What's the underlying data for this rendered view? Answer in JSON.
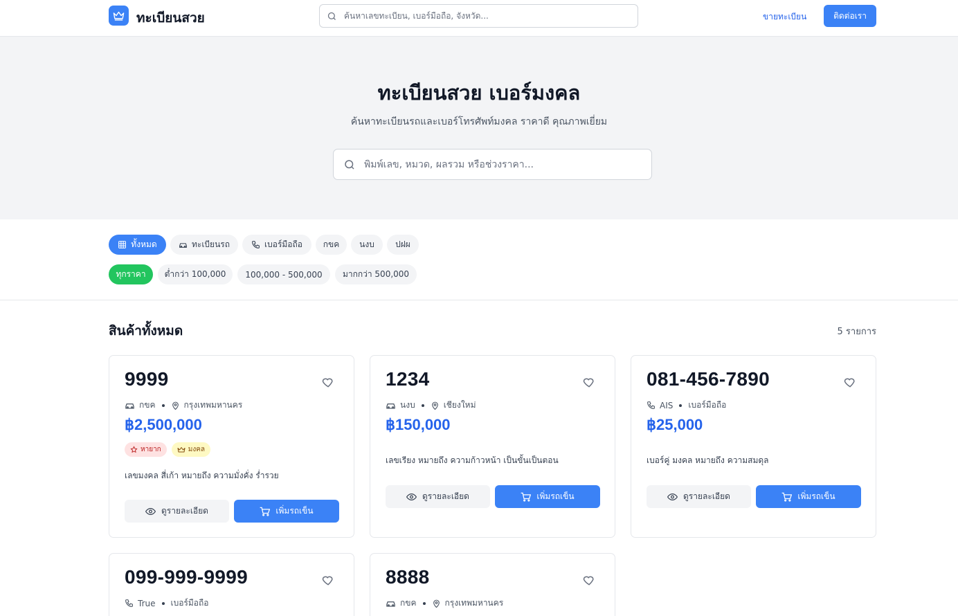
{
  "header": {
    "logo_text": "ทะเบียนสวย",
    "search_placeholder": "ค้นหาเลขทะเบียน, เบอร์มือถือ, จังหวัด...",
    "sell_link": "ขายทะเบียน",
    "contact_button": "ติดต่อเรา"
  },
  "hero": {
    "title": "ทะเบียนสวย เบอร์มงคล",
    "subtitle": "ค้นหาทะเบียนรถและเบอร์โทรศัพท์มงคล ราคาดี คุณภาพเยี่ยม",
    "search_placeholder": "พิมพ์เลข, หมวด, ผลรวม หรือช่วงราคา..."
  },
  "category_filters": [
    "ทั้งหมด",
    "ทะเบียนรถ",
    "เบอร์มือถือ",
    "กขค",
    "นงบ",
    "ปฝผ"
  ],
  "price_filters": [
    "ทุกราคา",
    "ต่ำกว่า 100,000",
    "100,000 - 500,000",
    "มากกว่า 500,000"
  ],
  "section": {
    "title": "สินค้าทั้งหมด",
    "count": "5 รายการ"
  },
  "card_labels": {
    "detail": "ดูรายละเอียด",
    "cart": "เพิ่มรถเข็น"
  },
  "products": [
    {
      "number": "9999",
      "meta1": "กขค",
      "meta2": "กรุงเทพมหานคร",
      "price": "฿2,500,000",
      "badges": [
        "หายาก",
        "มงคล"
      ],
      "description": "เลขมงคล สี่เก้า หมายถึง ความมั่งคั่ง ร่ำรวย"
    },
    {
      "number": "1234",
      "meta1": "นงบ",
      "meta2": "เชียงใหม่",
      "price": "฿150,000",
      "badges": [],
      "description": "เลขเรียง หมายถึง ความก้าวหน้า เป็นขั้นเป็นตอน"
    },
    {
      "number": "081-456-7890",
      "meta1": "AIS",
      "meta2": "เบอร์มือถือ",
      "price": "฿25,000",
      "badges": [],
      "description": "เบอร์คู่ มงคล หมายถึง ความสมดุล"
    },
    {
      "number": "099-999-9999",
      "meta1": "True",
      "meta2": "เบอร์มือถือ"
    },
    {
      "number": "8888",
      "meta1": "กขค",
      "meta2": "กรุงเทพมหานคร"
    }
  ],
  "colors": {
    "primary": "#3b82f6",
    "price": "#2563eb",
    "success": "#22c55e"
  }
}
